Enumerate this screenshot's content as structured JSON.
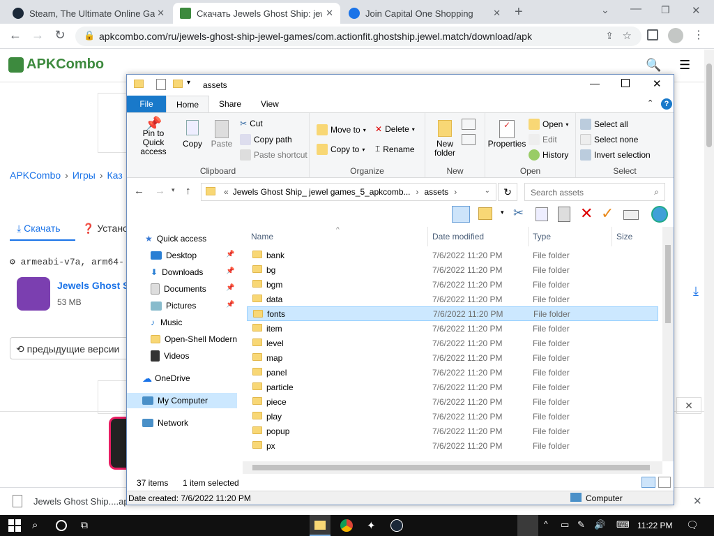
{
  "browser": {
    "tabs": [
      {
        "label": "Steam, The Ultimate Online Gam",
        "active": false
      },
      {
        "label": "Скачать Jewels Ghost Ship: jewe",
        "active": true
      },
      {
        "label": "Join Capital One Shopping",
        "active": false
      }
    ],
    "url": "apkcombo.com/ru/jewels-ghost-ship-jewel-games/com.actionfit.ghostship.jewel.match/download/apk"
  },
  "page": {
    "logo": "APKCombo",
    "breadcrumb": [
      "APKCombo",
      "Игры",
      "Каз"
    ],
    "download_tab": "Скачать",
    "install_tab": "Устано",
    "arch": "armeabi-v7a, arm64-",
    "app_name": "Jewels Ghost Sh",
    "app_size": "53 MB",
    "prev_versions": "предыдущие версии"
  },
  "explorer": {
    "title": "assets",
    "ribbon_tabs": [
      "File",
      "Home",
      "Share",
      "View"
    ],
    "clipboard": {
      "pin": "Pin to Quick access",
      "copy": "Copy",
      "paste": "Paste",
      "cut": "Cut",
      "copy_path": "Copy path",
      "paste_shortcut": "Paste shortcut",
      "label": "Clipboard"
    },
    "organize": {
      "move_to": "Move to",
      "copy_to": "Copy to",
      "delete": "Delete",
      "rename": "Rename",
      "label": "Organize"
    },
    "new": {
      "new_folder": "New folder",
      "label": "New"
    },
    "open": {
      "properties": "Properties",
      "open": "Open",
      "edit": "Edit",
      "history": "History",
      "label": "Open"
    },
    "select": {
      "select_all": "Select all",
      "select_none": "Select none",
      "invert": "Invert selection",
      "label": "Select"
    },
    "path": [
      "Jewels Ghost Ship_ jewel games_5_apkcomb...",
      "assets"
    ],
    "search_placeholder": "Search assets",
    "nav": [
      {
        "label": "Quick access",
        "icon": "star-icon"
      },
      {
        "label": "Desktop",
        "icon": "desktop-icon"
      },
      {
        "label": "Downloads",
        "icon": "download-icon"
      },
      {
        "label": "Documents",
        "icon": "documents-icon"
      },
      {
        "label": "Pictures",
        "icon": "pictures-icon"
      },
      {
        "label": "Music",
        "icon": "music-icon"
      },
      {
        "label": "Open-Shell Modern",
        "icon": "folder-icon"
      },
      {
        "label": "Videos",
        "icon": "videos-icon"
      },
      {
        "label": "OneDrive",
        "icon": "cloud-icon"
      },
      {
        "label": "My Computer",
        "icon": "computer-icon"
      },
      {
        "label": "Network",
        "icon": "network-icon"
      }
    ],
    "columns": [
      "Name",
      "Date modified",
      "Type",
      "Size"
    ],
    "files": [
      {
        "name": "bank",
        "date": "7/6/2022 11:20 PM",
        "type": "File folder"
      },
      {
        "name": "bg",
        "date": "7/6/2022 11:20 PM",
        "type": "File folder"
      },
      {
        "name": "bgm",
        "date": "7/6/2022 11:20 PM",
        "type": "File folder"
      },
      {
        "name": "data",
        "date": "7/6/2022 11:20 PM",
        "type": "File folder"
      },
      {
        "name": "fonts",
        "date": "7/6/2022 11:20 PM",
        "type": "File folder"
      },
      {
        "name": "item",
        "date": "7/6/2022 11:20 PM",
        "type": "File folder"
      },
      {
        "name": "level",
        "date": "7/6/2022 11:20 PM",
        "type": "File folder"
      },
      {
        "name": "map",
        "date": "7/6/2022 11:20 PM",
        "type": "File folder"
      },
      {
        "name": "panel",
        "date": "7/6/2022 11:20 PM",
        "type": "File folder"
      },
      {
        "name": "particle",
        "date": "7/6/2022 11:20 PM",
        "type": "File folder"
      },
      {
        "name": "piece",
        "date": "7/6/2022 11:20 PM",
        "type": "File folder"
      },
      {
        "name": "play",
        "date": "7/6/2022 11:20 PM",
        "type": "File folder"
      },
      {
        "name": "popup",
        "date": "7/6/2022 11:20 PM",
        "type": "File folder"
      },
      {
        "name": "px",
        "date": "7/6/2022 11:20 PM",
        "type": "File folder"
      }
    ],
    "selected_file": "fonts",
    "status": {
      "count": "37 items",
      "selected": "1 item selected"
    },
    "info": {
      "date_created": "Date created: 7/6/2022 11:20 PM",
      "location": "Computer"
    }
  },
  "download_bar": {
    "file": "Jewels Ghost Ship....apk"
  },
  "taskbar": {
    "time": "11:22 PM"
  },
  "colors": {
    "accent": "#1979ca",
    "selection": "#cce8ff",
    "folder": "#f8d775",
    "logo_green": "#3d8a3e"
  }
}
